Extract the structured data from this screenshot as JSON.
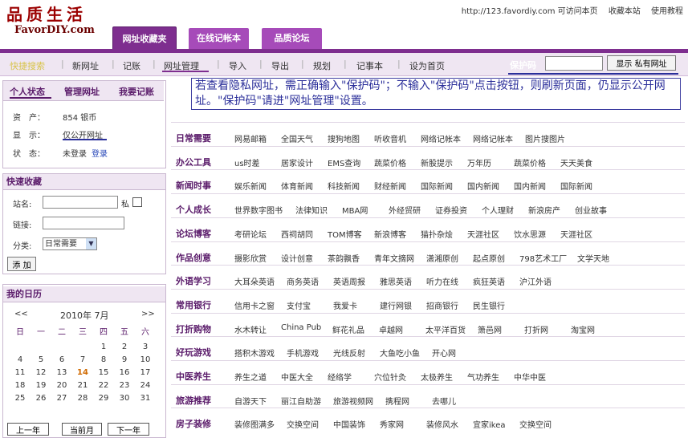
{
  "header": {
    "logo_cn": "品质生活",
    "logo_en": "FavorDIY.com",
    "toplinks": [
      "http://123.favordiy.com 可访问本页",
      "收藏本站",
      "使用教程"
    ]
  },
  "tabs": [
    "网址收藏夹",
    "在线记帐本",
    "品质论坛"
  ],
  "nav": [
    "快捷搜索",
    "新网址",
    "记账",
    "网址管理",
    "导入",
    "导出",
    "规划",
    "记事本",
    "设为首页"
  ],
  "password": {
    "label": "保护码",
    "value": "",
    "button": "显示 私有网址"
  },
  "annotation": "若查看隐私网址，需正确输入\"保护码\"；不输入\"保护码\"点击按钮，则刷新页面，仍显示公开网址。\"保护码\"请进\"网址管理\"设置。",
  "status": {
    "tabs": [
      "个人状态",
      "管理网址",
      "我要记账"
    ],
    "rows": [
      {
        "label": "资　产：",
        "value": "854 银币"
      },
      {
        "label": "显　示：",
        "value": "仅公开网址"
      },
      {
        "label": "状　态：",
        "value": "未登录",
        "link": "登录"
      }
    ]
  },
  "quick": {
    "title": "快速收藏",
    "name_label": "站名:",
    "private_label": "私",
    "link_label": "链接:",
    "category_label": "分类:",
    "category_value": "日常需要",
    "add_button": "添 加"
  },
  "calendar": {
    "title": "我的日历",
    "prev": "<<",
    "month": "2010年 7月",
    "next": ">>",
    "weekdays": [
      "日",
      "一",
      "二",
      "三",
      "四",
      "五",
      "六"
    ],
    "weeks": [
      [
        "",
        "",
        "",
        "",
        "1",
        "2",
        "3"
      ],
      [
        "4",
        "5",
        "6",
        "7",
        "8",
        "9",
        "10"
      ],
      [
        "11",
        "12",
        "13",
        "14",
        "15",
        "16",
        "17"
      ],
      [
        "18",
        "19",
        "20",
        "21",
        "22",
        "23",
        "24"
      ],
      [
        "25",
        "26",
        "27",
        "28",
        "29",
        "30",
        "31"
      ]
    ],
    "today": "14",
    "buttons": [
      "上一年",
      "当前月",
      "下一年"
    ]
  },
  "categories": [
    {
      "name": "日常需要",
      "links": [
        "网易邮箱",
        "全国天气",
        "搜狗地图",
        "听收音机",
        "网络记帐本",
        "网络记帐本",
        "图片搜图片"
      ]
    },
    {
      "name": "办公工具",
      "links": [
        "us时差",
        "居家设计",
        "EMS查询",
        "蔬菜价格",
        "新股提示",
        "万年历",
        "蔬菜价格",
        "天天美食"
      ]
    },
    {
      "name": "新闻时事",
      "links": [
        "娱乐新闻",
        "体育新闻",
        "科技新闻",
        "财经新闻",
        "国际新闻",
        "国内新闻",
        "国内新闻",
        "国际新闻"
      ]
    },
    {
      "name": "个人成长",
      "links": [
        "世界数字图书",
        "法律知识",
        "MBA网",
        "外经贸研",
        "证券投资",
        "个人理财",
        "新浪房产",
        "创业故事"
      ]
    },
    {
      "name": "论坛博客",
      "links": [
        "考研论坛",
        "西祠胡同",
        "TOM博客",
        "新浪博客",
        "猫扑杂烩",
        "天涯社区",
        "饮水思源",
        "天涯社区"
      ]
    },
    {
      "name": "作品创意",
      "links": [
        "摄影欣赏",
        "设计创意",
        "茶韵飘香",
        "青年文摘网",
        "潇湘原创",
        "起点原创",
        "798艺术工厂",
        "文学天地"
      ]
    },
    {
      "name": "外语学习",
      "links": [
        "大耳朵英语",
        "商务英语",
        "英语周报",
        "雅思英语",
        "听力在线",
        "疯狂英语",
        "沪江外语"
      ]
    },
    {
      "name": "常用银行",
      "links": [
        "信用卡之窗",
        "支付宝",
        "我爱卡",
        "建行网银",
        "招商银行",
        "民生银行"
      ]
    },
    {
      "name": "打折购物",
      "links": [
        "水木转让",
        "China Pub",
        "鲜花礼品",
        "卓越网",
        "太平洋百货",
        "箫邑网",
        "打折网",
        "淘宝网"
      ]
    },
    {
      "name": "好玩游戏",
      "links": [
        "搭积木游戏",
        "手机游戏",
        "光线反射",
        "大鱼吃小鱼",
        "开心网"
      ]
    },
    {
      "name": "中医养生",
      "links": [
        "养生之道",
        "中医大全",
        "经络学",
        "穴位针灸",
        "太极养生",
        "气功养生",
        "中华中医"
      ]
    },
    {
      "name": "旅游推荐",
      "links": [
        "自游天下",
        "丽江自助游",
        "旅游视频网",
        "携程网",
        "去哪儿"
      ]
    },
    {
      "name": "房子装修",
      "links": [
        "装修图满多",
        "交换空间",
        "中国装饰",
        "秀家网",
        "装修风水",
        "宜家ikea",
        "交换空间"
      ]
    }
  ]
}
